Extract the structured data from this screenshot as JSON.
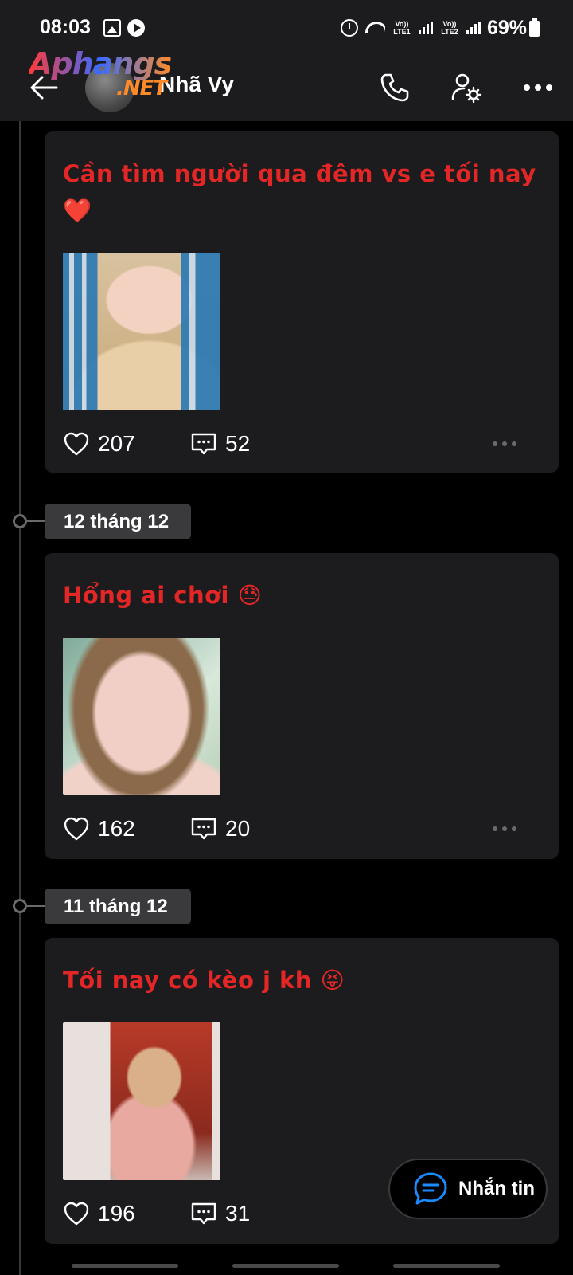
{
  "status_bar": {
    "time": "08:03",
    "sim1": "Vo)) LTE1",
    "sim2": "Vo)) LTE2",
    "battery": "69%"
  },
  "header": {
    "contact_name": "Nhã Vy",
    "watermark_main": "Aphangs",
    "watermark_suffix": ".NET"
  },
  "posts": [
    {
      "text": "Cần tìm người qua đêm vs e tối nay",
      "emoji": "❤️",
      "likes": "207",
      "comments": "52"
    },
    {
      "date": "12 tháng 12",
      "text": "Hổng ai chơi",
      "emoji": "😓",
      "likes": "162",
      "comments": "20"
    },
    {
      "date": "11 tháng 12",
      "text": "Tối nay có kèo j kh",
      "emoji": "😝",
      "likes": "196",
      "comments": "31"
    }
  ],
  "message_button": {
    "label": "Nhắn tin"
  },
  "colors": {
    "post_text": "#e32626",
    "card_bg": "#1c1c1e",
    "accent_blue": "#1a8cff"
  }
}
